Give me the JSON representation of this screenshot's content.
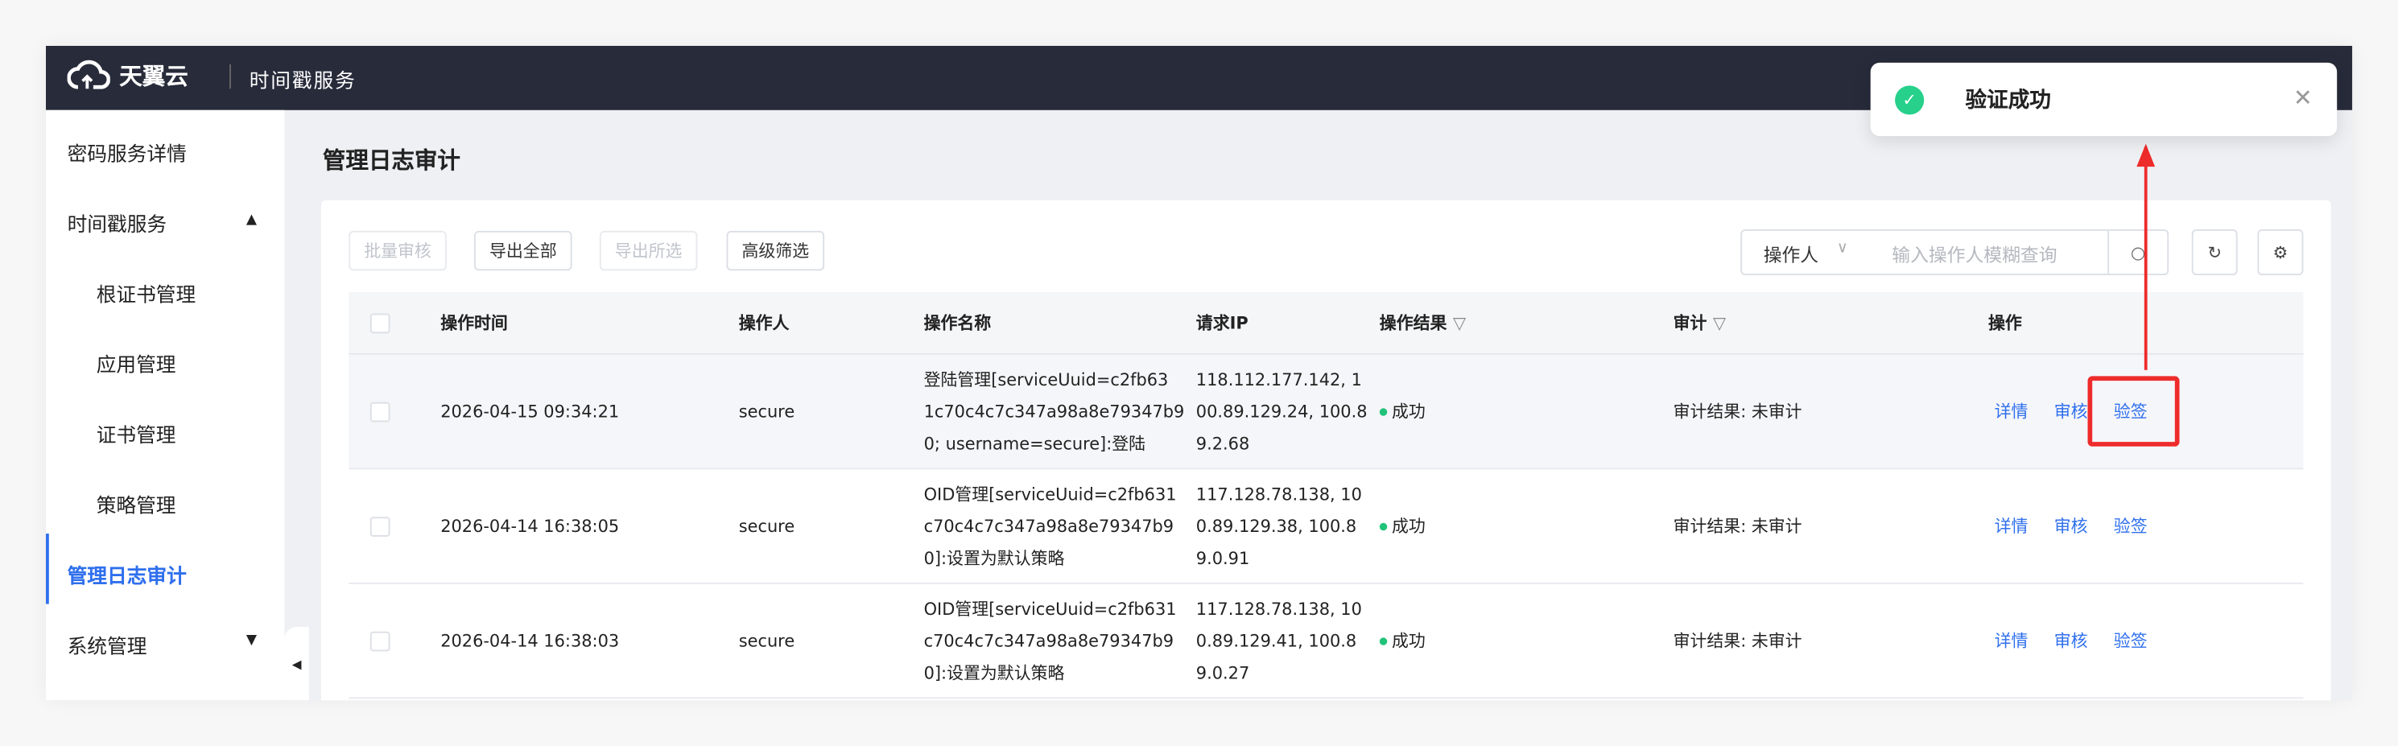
{
  "header": {
    "brand": "天翼云",
    "service": "时间戳服务"
  },
  "sidebar": {
    "items": [
      {
        "label": "密码服务详情"
      },
      {
        "label": "时间戳服务"
      },
      {
        "label": "根证书管理"
      },
      {
        "label": "应用管理"
      },
      {
        "label": "证书管理"
      },
      {
        "label": "策略管理"
      },
      {
        "label": "管理日志审计"
      },
      {
        "label": "系统管理"
      }
    ]
  },
  "page": {
    "title": "管理日志审计"
  },
  "toolbar": {
    "batch_audit": "批量审核",
    "export_all": "导出全部",
    "export_selected": "导出所选",
    "advanced_filter": "高级筛选",
    "search_field": "操作人",
    "search_placeholder": "输入操作人模糊查询"
  },
  "table": {
    "headers": [
      "操作时间",
      "操作人",
      "操作名称",
      "请求IP",
      "操作结果",
      "审计",
      "操作"
    ],
    "rows": [
      {
        "time": "2026-04-15 09:34:21",
        "user": "secure",
        "name": [
          "登陆管理[serviceUuid=c2fb63",
          "1c70c4c7c347a98a8e79347b9",
          "0; username=secure]:登陆"
        ],
        "ip": [
          "118.112.177.142, 1",
          "00.89.129.24, 100.8",
          "9.2.68"
        ],
        "result": "成功",
        "audit": "审计结果: 未审计"
      },
      {
        "time": "2026-04-14 16:38:05",
        "user": "secure",
        "name": [
          "OID管理[serviceUuid=c2fb631",
          "c70c4c7c347a98a8e79347b9",
          "0]:设置为默认策略"
        ],
        "ip": [
          "117.128.78.138, 10",
          "0.89.129.38, 100.8",
          "9.0.91"
        ],
        "result": "成功",
        "audit": "审计结果: 未审计"
      },
      {
        "time": "2026-04-14 16:38:03",
        "user": "secure",
        "name": [
          "OID管理[serviceUuid=c2fb631",
          "c70c4c7c347a98a8e79347b9",
          "0]:设置为默认策略"
        ],
        "ip": [
          "117.128.78.138, 10",
          "0.89.129.41, 100.8",
          "9.0.27"
        ],
        "result": "成功",
        "audit": "审计结果: 未审计"
      }
    ],
    "actions": [
      "详情",
      "审核",
      "验签"
    ]
  },
  "toast": {
    "message": "验证成功"
  }
}
